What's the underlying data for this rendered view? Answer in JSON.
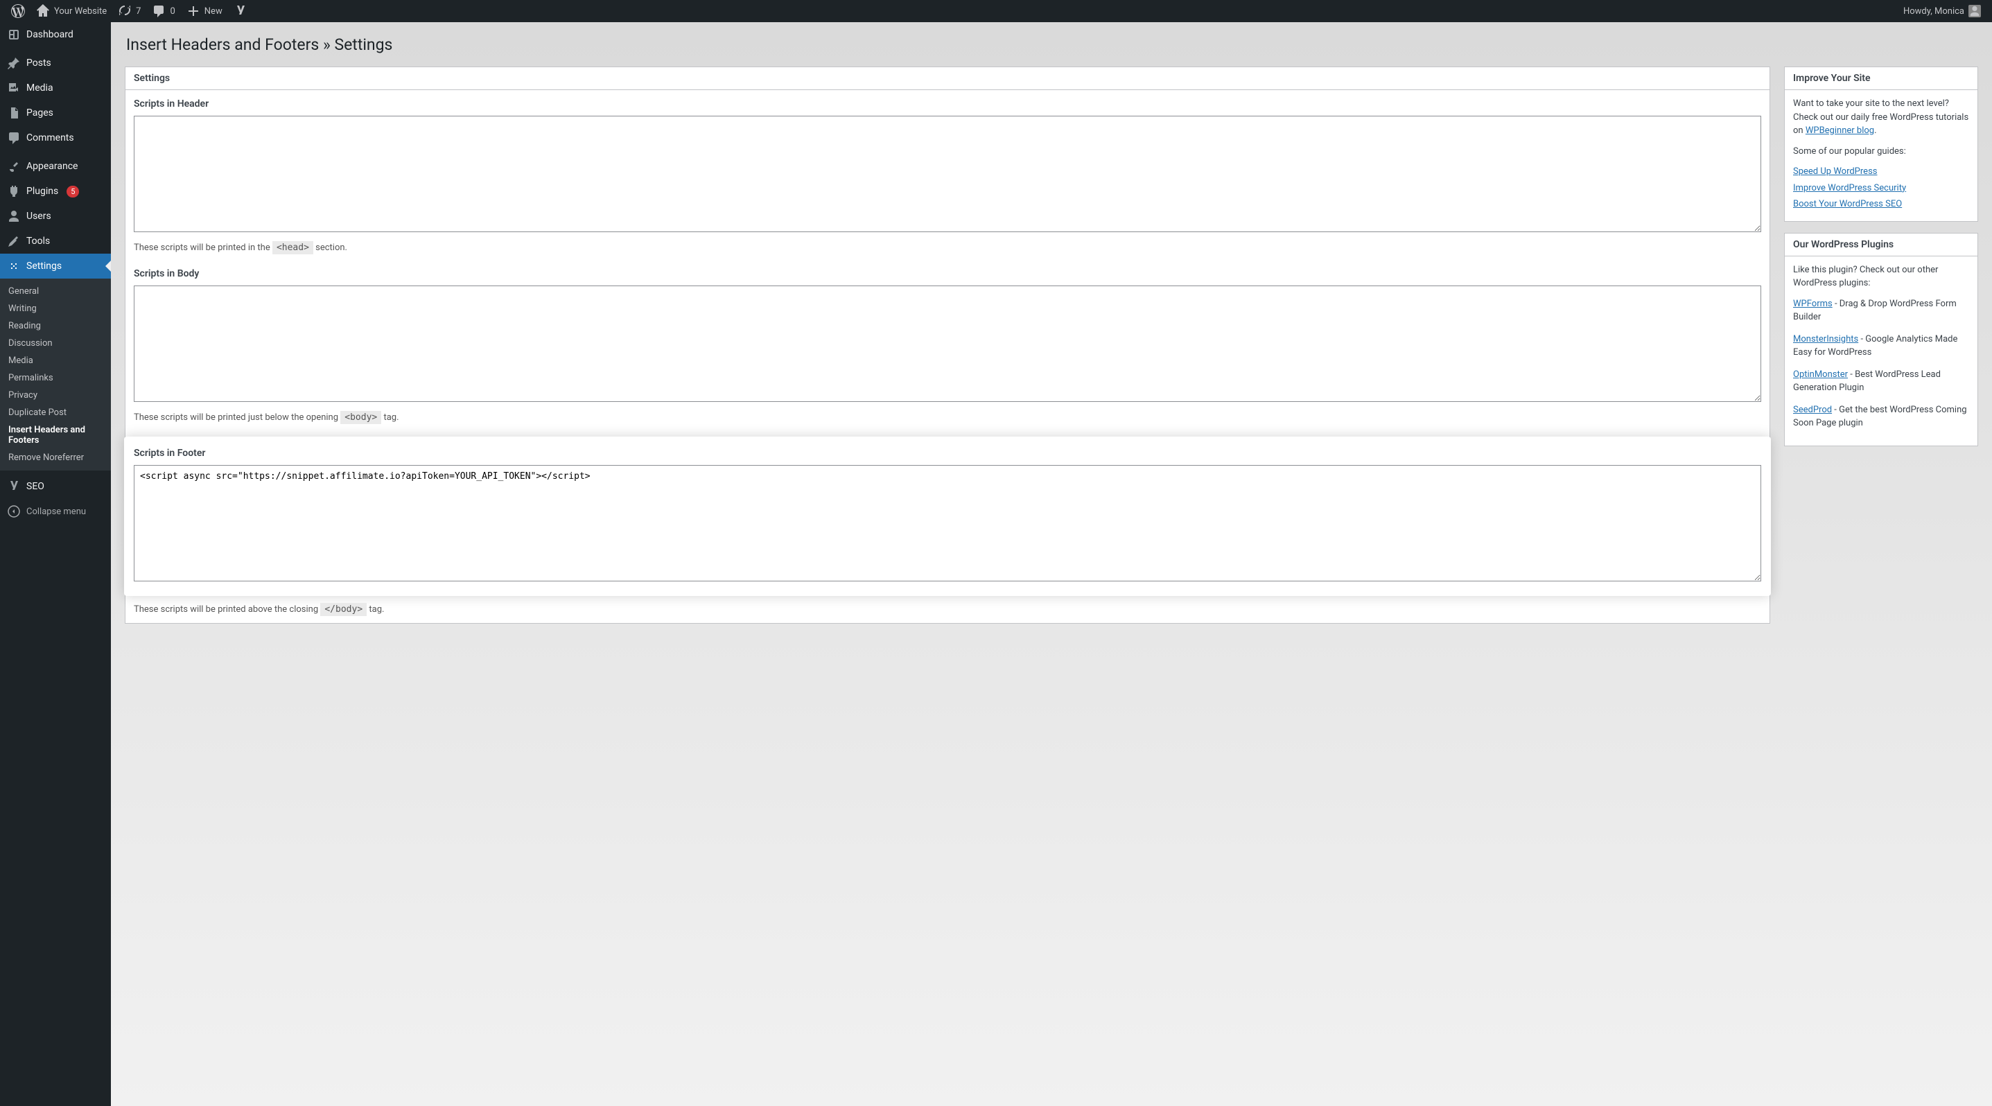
{
  "adminbar": {
    "site_name": "Your Website",
    "updates": "7",
    "comments": "0",
    "new_label": "New",
    "howdy": "Howdy, Monica"
  },
  "sidebar": {
    "dashboard": "Dashboard",
    "posts": "Posts",
    "media": "Media",
    "pages": "Pages",
    "comments": "Comments",
    "appearance": "Appearance",
    "plugins": "Plugins",
    "plugins_badge": "5",
    "users": "Users",
    "tools": "Tools",
    "settings": "Settings",
    "settings_sub": {
      "general": "General",
      "writing": "Writing",
      "reading": "Reading",
      "discussion": "Discussion",
      "media": "Media",
      "permalinks": "Permalinks",
      "privacy": "Privacy",
      "duplicate_post": "Duplicate Post",
      "ihf": "Insert Headers and Footers",
      "remove_noreferrer": "Remove Noreferrer"
    },
    "seo": "SEO",
    "collapse": "Collapse menu"
  },
  "page": {
    "title": "Insert Headers and Footers » Settings",
    "settings_heading": "Settings",
    "header_label": "Scripts in Header",
    "header_value": "",
    "header_hint_pre": "These scripts will be printed in the ",
    "header_hint_code": "<head>",
    "header_hint_post": " section.",
    "body_label": "Scripts in Body",
    "body_value": "",
    "body_hint_pre": "These scripts will be printed just below the opening ",
    "body_hint_code": "<body>",
    "body_hint_post": " tag.",
    "footer_label": "Scripts in Footer",
    "footer_value": "<script async src=\"https://snippet.affilimate.io?apiToken=YOUR_API_TOKEN\"></script>",
    "footer_hint_pre": "These scripts will be printed above the closing ",
    "footer_hint_code": "</body>",
    "footer_hint_post": " tag."
  },
  "improve": {
    "heading": "Improve Your Site",
    "intro_pre": "Want to take your site to the next level? Check out our daily free WordPress tutorials on ",
    "intro_link": "WPBeginner blog",
    "intro_post": ".",
    "guides_label": "Some of our popular guides:",
    "guide1": "Speed Up WordPress",
    "guide2": "Improve WordPress Security",
    "guide3": "Boost Your WordPress SEO"
  },
  "plugins_panel": {
    "heading": "Our WordPress Plugins",
    "intro": "Like this plugin? Check out our other WordPress plugins:",
    "wpforms_name": "WPForms",
    "wpforms_desc": " - Drag & Drop WordPress Form Builder",
    "mi_name": "MonsterInsights",
    "mi_desc": " - Google Analytics Made Easy for WordPress",
    "om_name": "OptinMonster",
    "om_desc": " - Best WordPress Lead Generation Plugin",
    "sp_name": "SeedProd",
    "sp_desc": " - Get the best WordPress Coming Soon Page plugin"
  }
}
